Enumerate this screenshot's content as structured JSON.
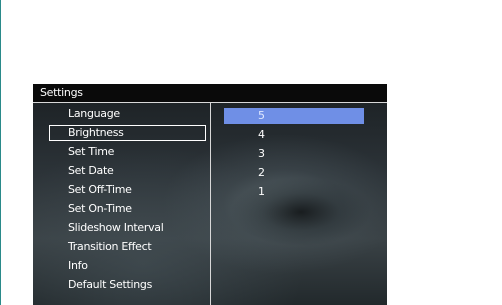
{
  "settings_window": {
    "title": "Settings",
    "menu_items": [
      {
        "label": "Language"
      },
      {
        "label": "Brightness"
      },
      {
        "label": "Set Time"
      },
      {
        "label": "Set Date"
      },
      {
        "label": "Set Off-Time"
      },
      {
        "label": "Set On-Time"
      },
      {
        "label": "Slideshow Interval"
      },
      {
        "label": "Transition Effect"
      },
      {
        "label": "Info"
      },
      {
        "label": "Default Settings"
      }
    ],
    "selected_menu_item": "Brightness",
    "brightness_options": [
      {
        "label": "5"
      },
      {
        "label": "4"
      },
      {
        "label": "3"
      },
      {
        "label": "2"
      },
      {
        "label": "1"
      }
    ],
    "highlighted_option": "5",
    "colors": {
      "highlight": "#6f8fe6",
      "titlebar": "#0a0a0a",
      "text": "#ffffff"
    }
  }
}
